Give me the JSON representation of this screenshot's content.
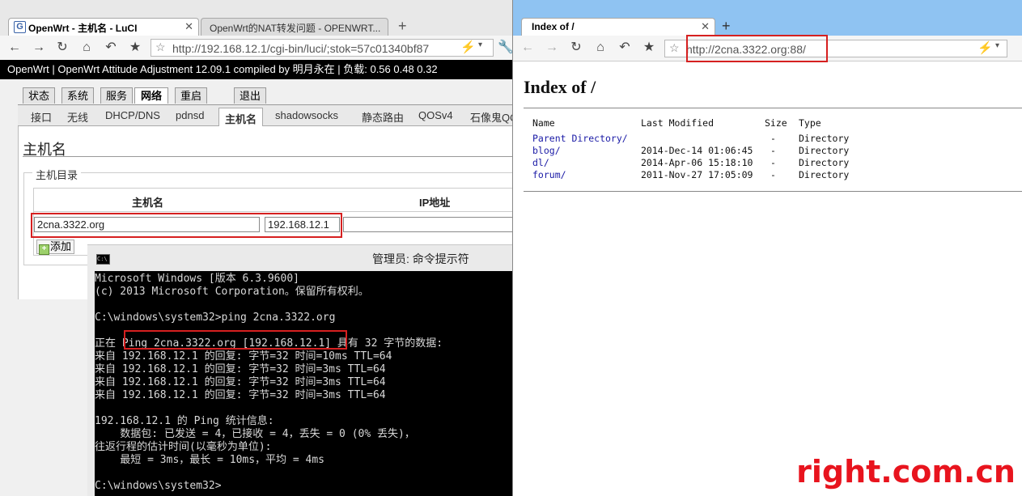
{
  "left_browser": {
    "tabs": [
      {
        "label": "OpenWrt - 主机名 - LuCI",
        "active": true
      },
      {
        "label": "OpenWrt的NAT转发问题 - OPENWRT...",
        "active": false
      }
    ],
    "new_tab_symbol": "+",
    "close_symbol": "✕",
    "url": "http://192.168.12.1/cgi-bin/luci/;stok=57c01340bf87",
    "banner": "OpenWrt | OpenWrt Attitude Adjustment 12.09.1 compiled by 明月永在 | 负载: 0.56 0.48 0.32",
    "main_tabs": [
      "状态",
      "系统",
      "服务",
      "网络",
      "重启",
      "退出"
    ],
    "active_main_tab": "网络",
    "sub_tabs": [
      "接口",
      "无线",
      "DHCP/DNS",
      "pdnsd",
      "主机名",
      "shadowsocks",
      "静态路由",
      "QOSv4",
      "石像鬼QOS"
    ],
    "active_sub_tab": "主机名",
    "page_title": "主机名",
    "section_legend": "主机目录",
    "table_headers": [
      "主机名",
      "IP地址"
    ],
    "host_value": "2cna.3322.org",
    "ip_value": "192.168.12.1",
    "add_label": "添加",
    "icons": [
      "back-icon",
      "forward-icon",
      "reload-icon",
      "home-icon",
      "undo-icon",
      "bookmark-star-icon",
      "lightning-icon",
      "dropdown-icon",
      "wrench-icon"
    ]
  },
  "cmd": {
    "title": "管理员: 命令提示符",
    "lines": [
      "Microsoft Windows [版本 6.3.9600]",
      "(c) 2013 Microsoft Corporation。保留所有权利。",
      "",
      "C:\\windows\\system32>ping 2cna.3322.org",
      "",
      "正在 Ping 2cna.3322.org [192.168.12.1] 具有 32 字节的数据:",
      "来自 192.168.12.1 的回复: 字节=32 时间=10ms TTL=64",
      "来自 192.168.12.1 的回复: 字节=32 时间=3ms TTL=64",
      "来自 192.168.12.1 的回复: 字节=32 时间=3ms TTL=64",
      "来自 192.168.12.1 的回复: 字节=32 时间=3ms TTL=64",
      "",
      "192.168.12.1 的 Ping 统计信息:",
      "    数据包: 已发送 = 4，已接收 = 4，丢失 = 0 (0% 丢失)，",
      "往返行程的估计时间(以毫秒为单位):",
      "    最短 = 3ms，最长 = 10ms，平均 = 4ms",
      "",
      "C:\\windows\\system32>"
    ]
  },
  "right_browser": {
    "tab_label": "Index of /",
    "close_symbol": "✕",
    "new_tab_symbol": "+",
    "url": "http://2cna.3322.org:88/",
    "heading": "Index of /",
    "columns": [
      "Name",
      "Last Modified",
      "Size",
      "Type"
    ],
    "rows": [
      {
        "name": "Parent Directory/",
        "modified": "",
        "size": "-",
        "type": "Directory"
      },
      {
        "name": "blog/",
        "modified": "2014-Dec-14 01:06:45",
        "size": "-",
        "type": "Directory"
      },
      {
        "name": "dl/",
        "modified": "2014-Apr-06 15:18:10",
        "size": "-",
        "type": "Directory"
      },
      {
        "name": "forum/",
        "modified": "2011-Nov-27 17:05:09",
        "size": "-",
        "type": "Directory"
      }
    ]
  },
  "watermark": "right.com.cn",
  "colors": {
    "highlight_border": "#d62020",
    "right_tabstrip": "#8fc3f2",
    "watermark": "#e8141e"
  }
}
